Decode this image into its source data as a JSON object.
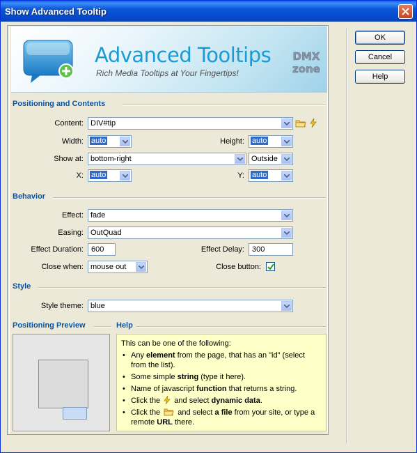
{
  "window": {
    "title": "Show Advanced Tooltip"
  },
  "banner": {
    "title": "Advanced Tooltips",
    "subtitle": "Rich Media Tooltips at Your Fingertips!",
    "logo_top": "DMX",
    "logo_bottom": "zone"
  },
  "positioning": {
    "section": "Positioning and Contents",
    "content_label": "Content:",
    "content_value": "DIV#tip",
    "width_label": "Width:",
    "width_value": "auto",
    "height_label": "Height:",
    "height_value": "auto",
    "showat_label": "Show at:",
    "showat_value": "bottom-right",
    "showat_mode": "Outside",
    "x_label": "X:",
    "x_value": "auto",
    "y_label": "Y:",
    "y_value": "auto"
  },
  "behavior": {
    "section": "Behavior",
    "effect_label": "Effect:",
    "effect_value": "fade",
    "easing_label": "Easing:",
    "easing_value": "OutQuad",
    "duration_label": "Effect Duration:",
    "duration_value": "600",
    "delay_label": "Effect Delay:",
    "delay_value": "300",
    "closewhen_label": "Close when:",
    "closewhen_value": "mouse out",
    "closebutton_label": "Close button:",
    "closebutton_checked": true
  },
  "style": {
    "section": "Style",
    "theme_label": "Style theme:",
    "theme_value": "blue"
  },
  "preview": {
    "section": "Positioning Preview"
  },
  "help": {
    "section": "Help",
    "intro": "This can be one of the following:",
    "items": [
      {
        "pre": "Any ",
        "bold": "element",
        "post": " from the page, that has an \"id\" (select from the list)."
      },
      {
        "pre": "Some simple ",
        "bold": "string",
        "post": " (type it here)."
      },
      {
        "pre": "Name of javascript ",
        "bold": "function",
        "post": " that returns a string."
      },
      {
        "pre": "Click the ",
        "icon": "lightning-icon",
        "mid": " and select ",
        "bold": "dynamic data",
        "post": "."
      },
      {
        "pre": "Click the ",
        "icon": "folder-icon",
        "mid": " and select ",
        "bold": "a file",
        "post": " from your site, or type a remote ",
        "bold2": "URL",
        "post2": " there."
      }
    ]
  },
  "buttons": {
    "ok": "OK",
    "cancel": "Cancel",
    "help": "Help"
  },
  "icons": {
    "folder": "folder-icon",
    "dynamic": "lightning-icon",
    "dropdown": "chevron-down-icon",
    "close": "close-icon"
  }
}
